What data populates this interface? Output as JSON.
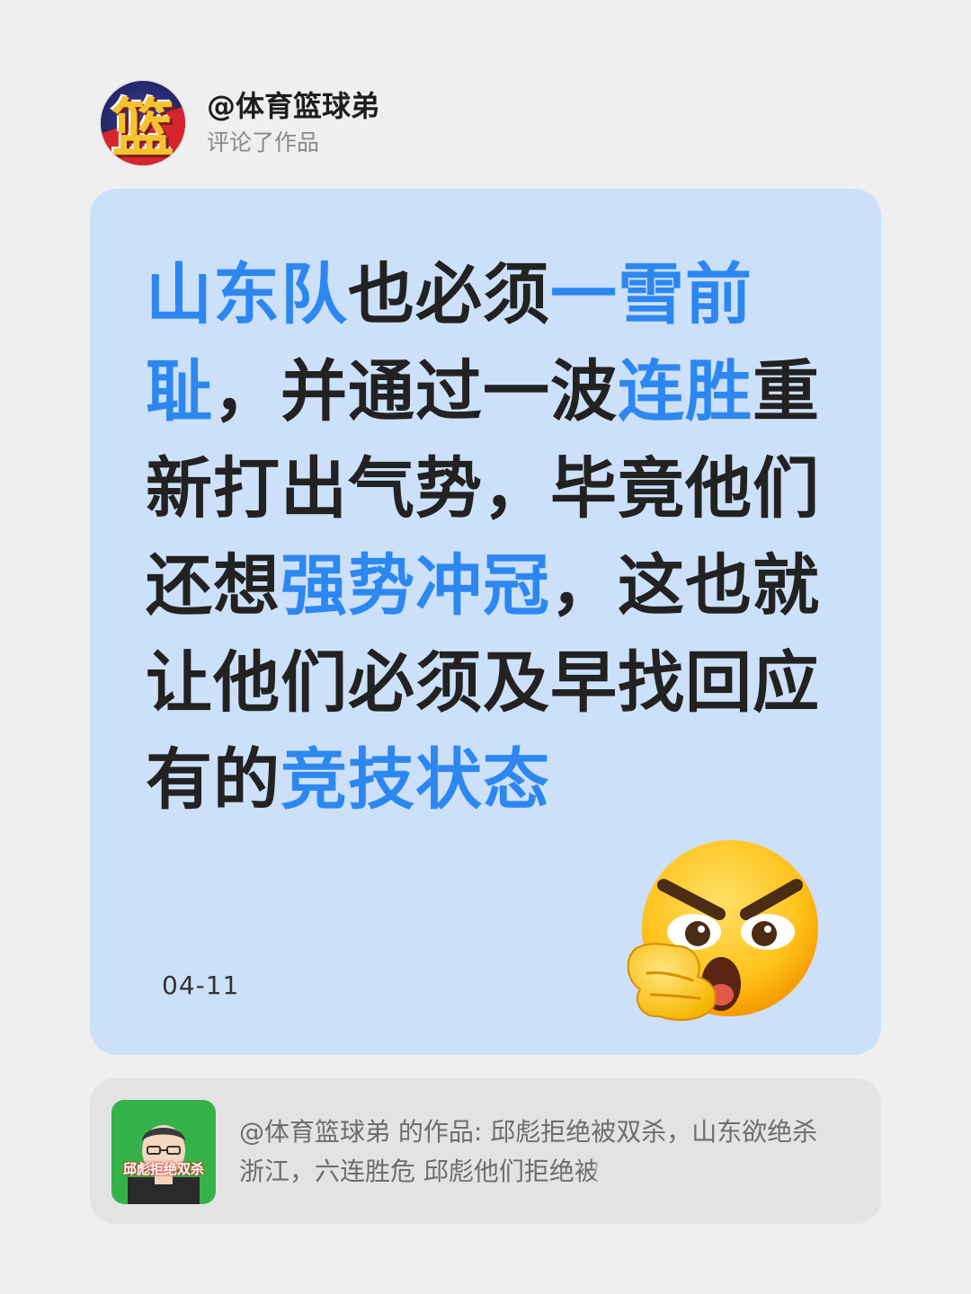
{
  "header": {
    "username": "@体育篮球弟",
    "subtitle": "评论了作品",
    "avatar_glyph": "篮"
  },
  "card": {
    "segments": [
      {
        "text": "山东队",
        "highlight": true
      },
      {
        "text": "也必须",
        "highlight": false
      },
      {
        "text": "一雪前耻",
        "highlight": true
      },
      {
        "text": "，并通过一波",
        "highlight": false
      },
      {
        "text": "连胜",
        "highlight": true
      },
      {
        "text": "重新打出气势，毕竟他们还想",
        "highlight": false
      },
      {
        "text": "强势冲冠",
        "highlight": true
      },
      {
        "text": "，这也就让他们必须及早找回应有的",
        "highlight": false
      },
      {
        "text": "竞技状态",
        "highlight": true
      }
    ],
    "date": "04-11",
    "emoji_icon": "angry-thinking-emoji-icon"
  },
  "reference": {
    "thumbnail_caption": "邱彪拒绝双杀",
    "text_main": "@体育篮球弟 的作品: 邱彪拒绝被双杀，山东欲绝杀浙江，六连胜危 邱彪他们拒绝",
    "text_fade": "被"
  },
  "colors": {
    "background": "#efefef",
    "card": "#cde0fa",
    "highlight": "#2d87f0",
    "text": "#222222",
    "reference_card": "#e3e3e3"
  }
}
